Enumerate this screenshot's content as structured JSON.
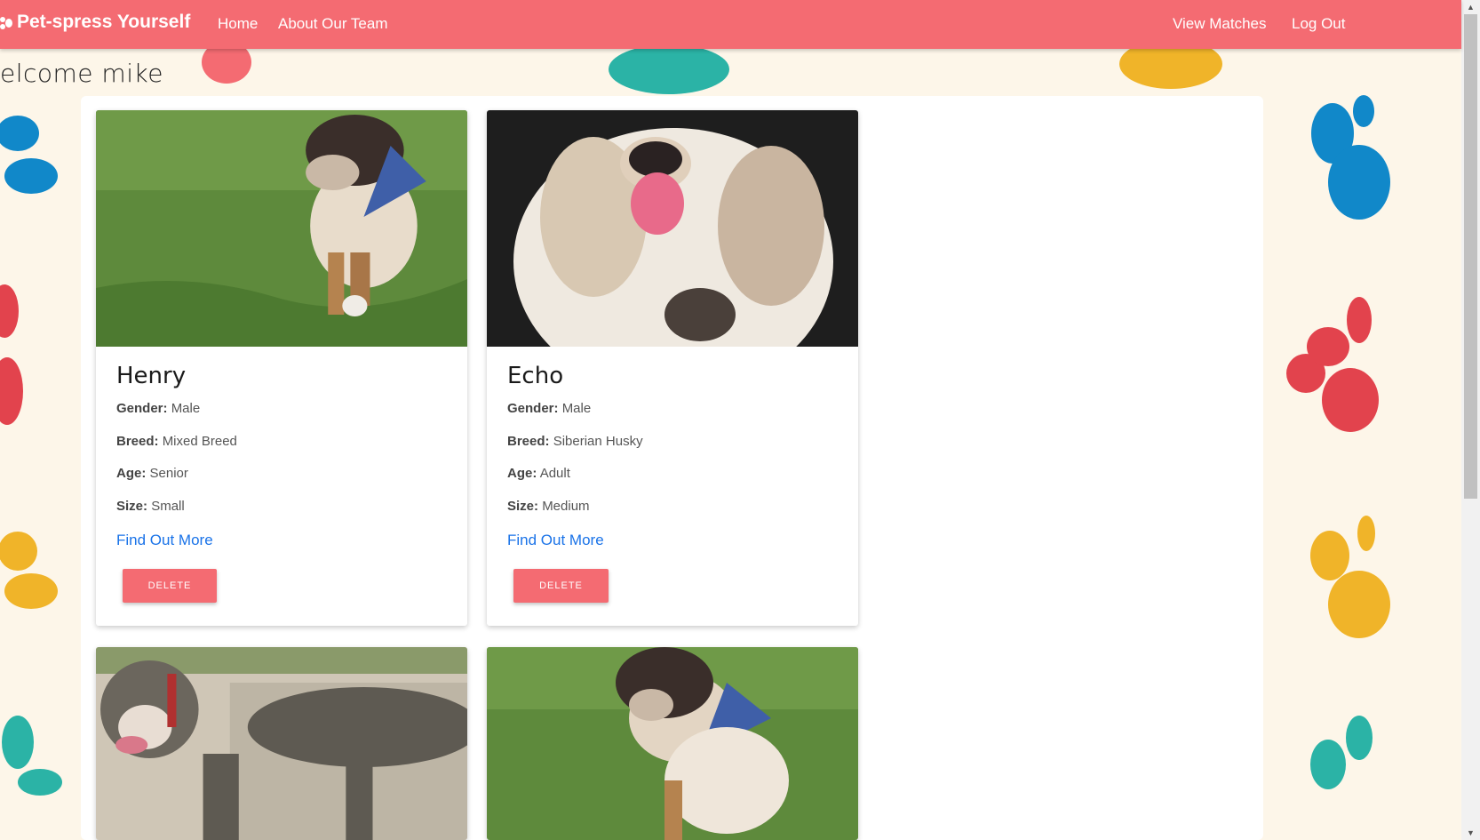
{
  "nav": {
    "brand": "Pet-spress Yourself",
    "home": "Home",
    "about": "About Our Team",
    "matches": "View Matches",
    "logout": "Log Out"
  },
  "welcome": "elcome mike",
  "colors": {
    "primary": "#f46b72",
    "background": "#fdf6e9",
    "link": "#1a73e8",
    "paw_red": "#e2434d",
    "paw_teal": "#2bb3a6",
    "paw_yellow": "#f0b429",
    "paw_blue": "#1188c9"
  },
  "labels": {
    "gender": "Gender:",
    "breed": "Breed:",
    "age": "Age:",
    "size": "Size:",
    "find_more": "Find Out More",
    "delete": "DELETE"
  },
  "pets": [
    {
      "name": "Henry",
      "gender": "Male",
      "breed": "Mixed Breed",
      "age": "Senior",
      "size": "Small",
      "photo": "dog-photo"
    },
    {
      "name": "Echo",
      "gender": "Male",
      "breed": "Siberian Husky",
      "age": "Adult",
      "size": "Medium",
      "photo": "dog-photo"
    },
    {
      "photo": "dog-photo"
    },
    {
      "photo": "dog-photo"
    }
  ]
}
